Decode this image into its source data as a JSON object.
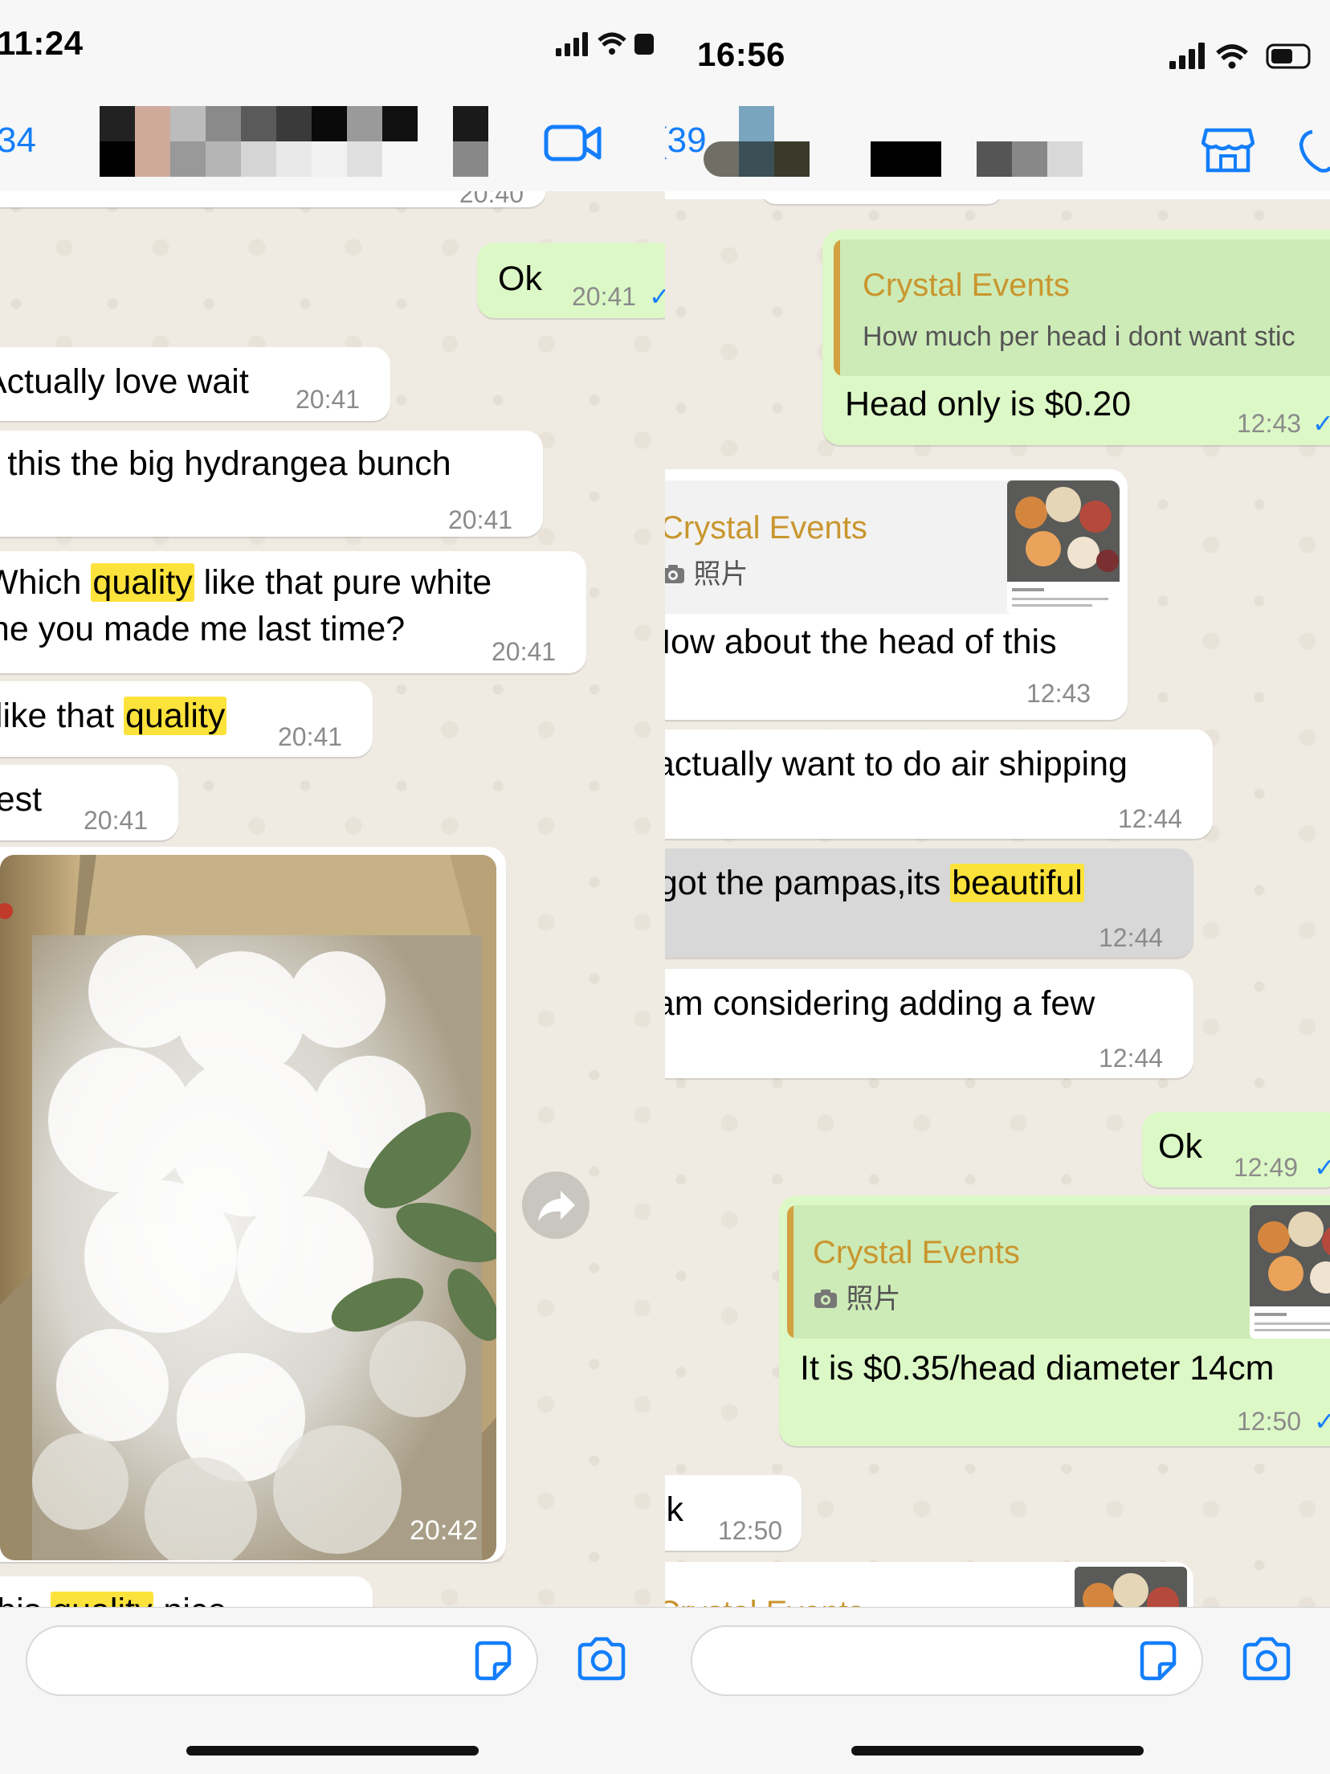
{
  "left": {
    "status_time": "11:24",
    "header": {
      "back_count": "34",
      "video_icon": "video-camera-icon"
    },
    "messages": [
      {
        "type": "date_stub",
        "text": "20:40"
      },
      {
        "dir": "out",
        "text": "Ok",
        "time": "20:41",
        "tick": "✓"
      },
      {
        "dir": "in",
        "text": "Actually love wait",
        "time": "20:41"
      },
      {
        "dir": "in",
        "text": "Is this the big hydrangea bunch",
        "time": "20:41"
      },
      {
        "dir": "in",
        "line1_pre": "Which ",
        "line1_hl": "quality",
        "line1_post": " like that pure white",
        "line2": "one you made me last time?",
        "time": "20:41"
      },
      {
        "dir": "in",
        "pre": "I like that ",
        "hl": "quality",
        "time": "20:41"
      },
      {
        "dir": "in",
        "text": "Best",
        "time": "20:41"
      },
      {
        "dir": "in",
        "type": "image",
        "desc": "box of white hydrangea flowers",
        "time": "20:42"
      },
      {
        "dir": "in",
        "pre": "This ",
        "hl": "quality",
        "post": " nice"
      }
    ],
    "forward_icon": "forward-arrow-icon",
    "input": {
      "placeholder": "",
      "sticker_icon": "sticker-icon",
      "camera_icon": "camera-icon"
    }
  },
  "right": {
    "status_time": "16:56",
    "header": {
      "back_count": "39",
      "store_icon": "storefront-icon",
      "phone_icon": "phone-icon"
    },
    "messages": [
      {
        "dir": "out",
        "quote_name": "Crystal Events",
        "quote_text": "How much per head i dont want stic",
        "text": "Head only is $0.20",
        "time": "12:43",
        "tick": "✓"
      },
      {
        "dir": "in",
        "quote_name": "Crystal Events",
        "quote_text": "照片",
        "text": "How about the head of this",
        "time": "12:43"
      },
      {
        "dir": "in",
        "text": "I actually want to do air shipping",
        "time": "12:44"
      },
      {
        "dir": "in",
        "pre": "I got the pampas,its ",
        "hl": "beautiful",
        "time": "12:44"
      },
      {
        "dir": "in",
        "text": "I am considering adding a few",
        "time": "12:44"
      },
      {
        "dir": "out",
        "text": "Ok",
        "time": "12:49",
        "tick": "✓"
      },
      {
        "dir": "out",
        "quote_name": "Crystal Events",
        "quote_text": "照片",
        "text": "It is $0.35/head diameter 14cm",
        "time": "12:50",
        "tick": "✓"
      },
      {
        "dir": "in",
        "text": "Ok",
        "time": "12:50"
      },
      {
        "dir": "in",
        "quote_name": "Crystal Events"
      }
    ],
    "input": {
      "placeholder": "",
      "sticker_icon": "sticker-icon",
      "camera_icon": "camera-icon"
    }
  },
  "colors": {
    "accent": "#147efb",
    "outgoing": "#dcf8c6",
    "incoming": "#ffffff",
    "highlight": "#fce33b",
    "quote_name": "#c9962e",
    "chat_bg": "#efeae2"
  }
}
